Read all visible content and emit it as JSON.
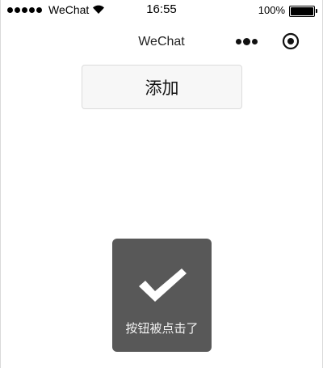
{
  "status_bar": {
    "carrier": "WeChat",
    "time": "16:55",
    "battery_percent": "100%"
  },
  "nav_bar": {
    "title": "WeChat",
    "more_icon": "more-dots-icon",
    "close_icon": "target-close-icon"
  },
  "main": {
    "add_button_label": "添加"
  },
  "toast": {
    "icon": "checkmark-icon",
    "message": "按钮被点击了"
  },
  "colors": {
    "toast_background": "#585858",
    "button_background": "#f7f7f7",
    "button_border": "#dcdcdc"
  }
}
